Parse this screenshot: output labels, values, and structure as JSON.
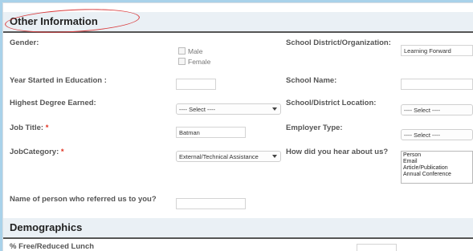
{
  "sections": {
    "other_information": "Other Information",
    "demographics": "Demographics"
  },
  "fields": {
    "gender": {
      "label": "Gender:",
      "options": [
        "Male",
        "Female"
      ]
    },
    "school_district": {
      "label": "School District/Organization:",
      "value": "Learning Forward"
    },
    "year_started": {
      "label": "Year Started in Education :",
      "value": ""
    },
    "school_name": {
      "label": "School Name:",
      "value": ""
    },
    "highest_degree": {
      "label": "Highest Degree Earned:",
      "selected": "---- Select ----"
    },
    "school_location": {
      "label": "School/District Location:",
      "selected": "---- Select ----"
    },
    "job_title": {
      "label": "Job Title:",
      "required_mark": "*",
      "value": "Batman"
    },
    "employer_type": {
      "label": "Employer Type:",
      "selected": "---- Select ----"
    },
    "job_category": {
      "label": "JobCategory:",
      "required_mark": "*",
      "selected": "External/Technical Assistance"
    },
    "hear_about": {
      "label": "How did you hear about us?",
      "options": [
        "Person",
        "Email",
        "Article/Publication",
        "Annual Conference"
      ]
    },
    "referrer": {
      "label": "Name of person who referred us to you?",
      "value": ""
    },
    "free_lunch": {
      "label": "% Free/Reduced Lunch",
      "value": ""
    }
  },
  "colors": {
    "background": "#a9d2ea",
    "section_bar": "#eaf0f5",
    "highlight": "#d8393b",
    "required": "#e0301e"
  }
}
